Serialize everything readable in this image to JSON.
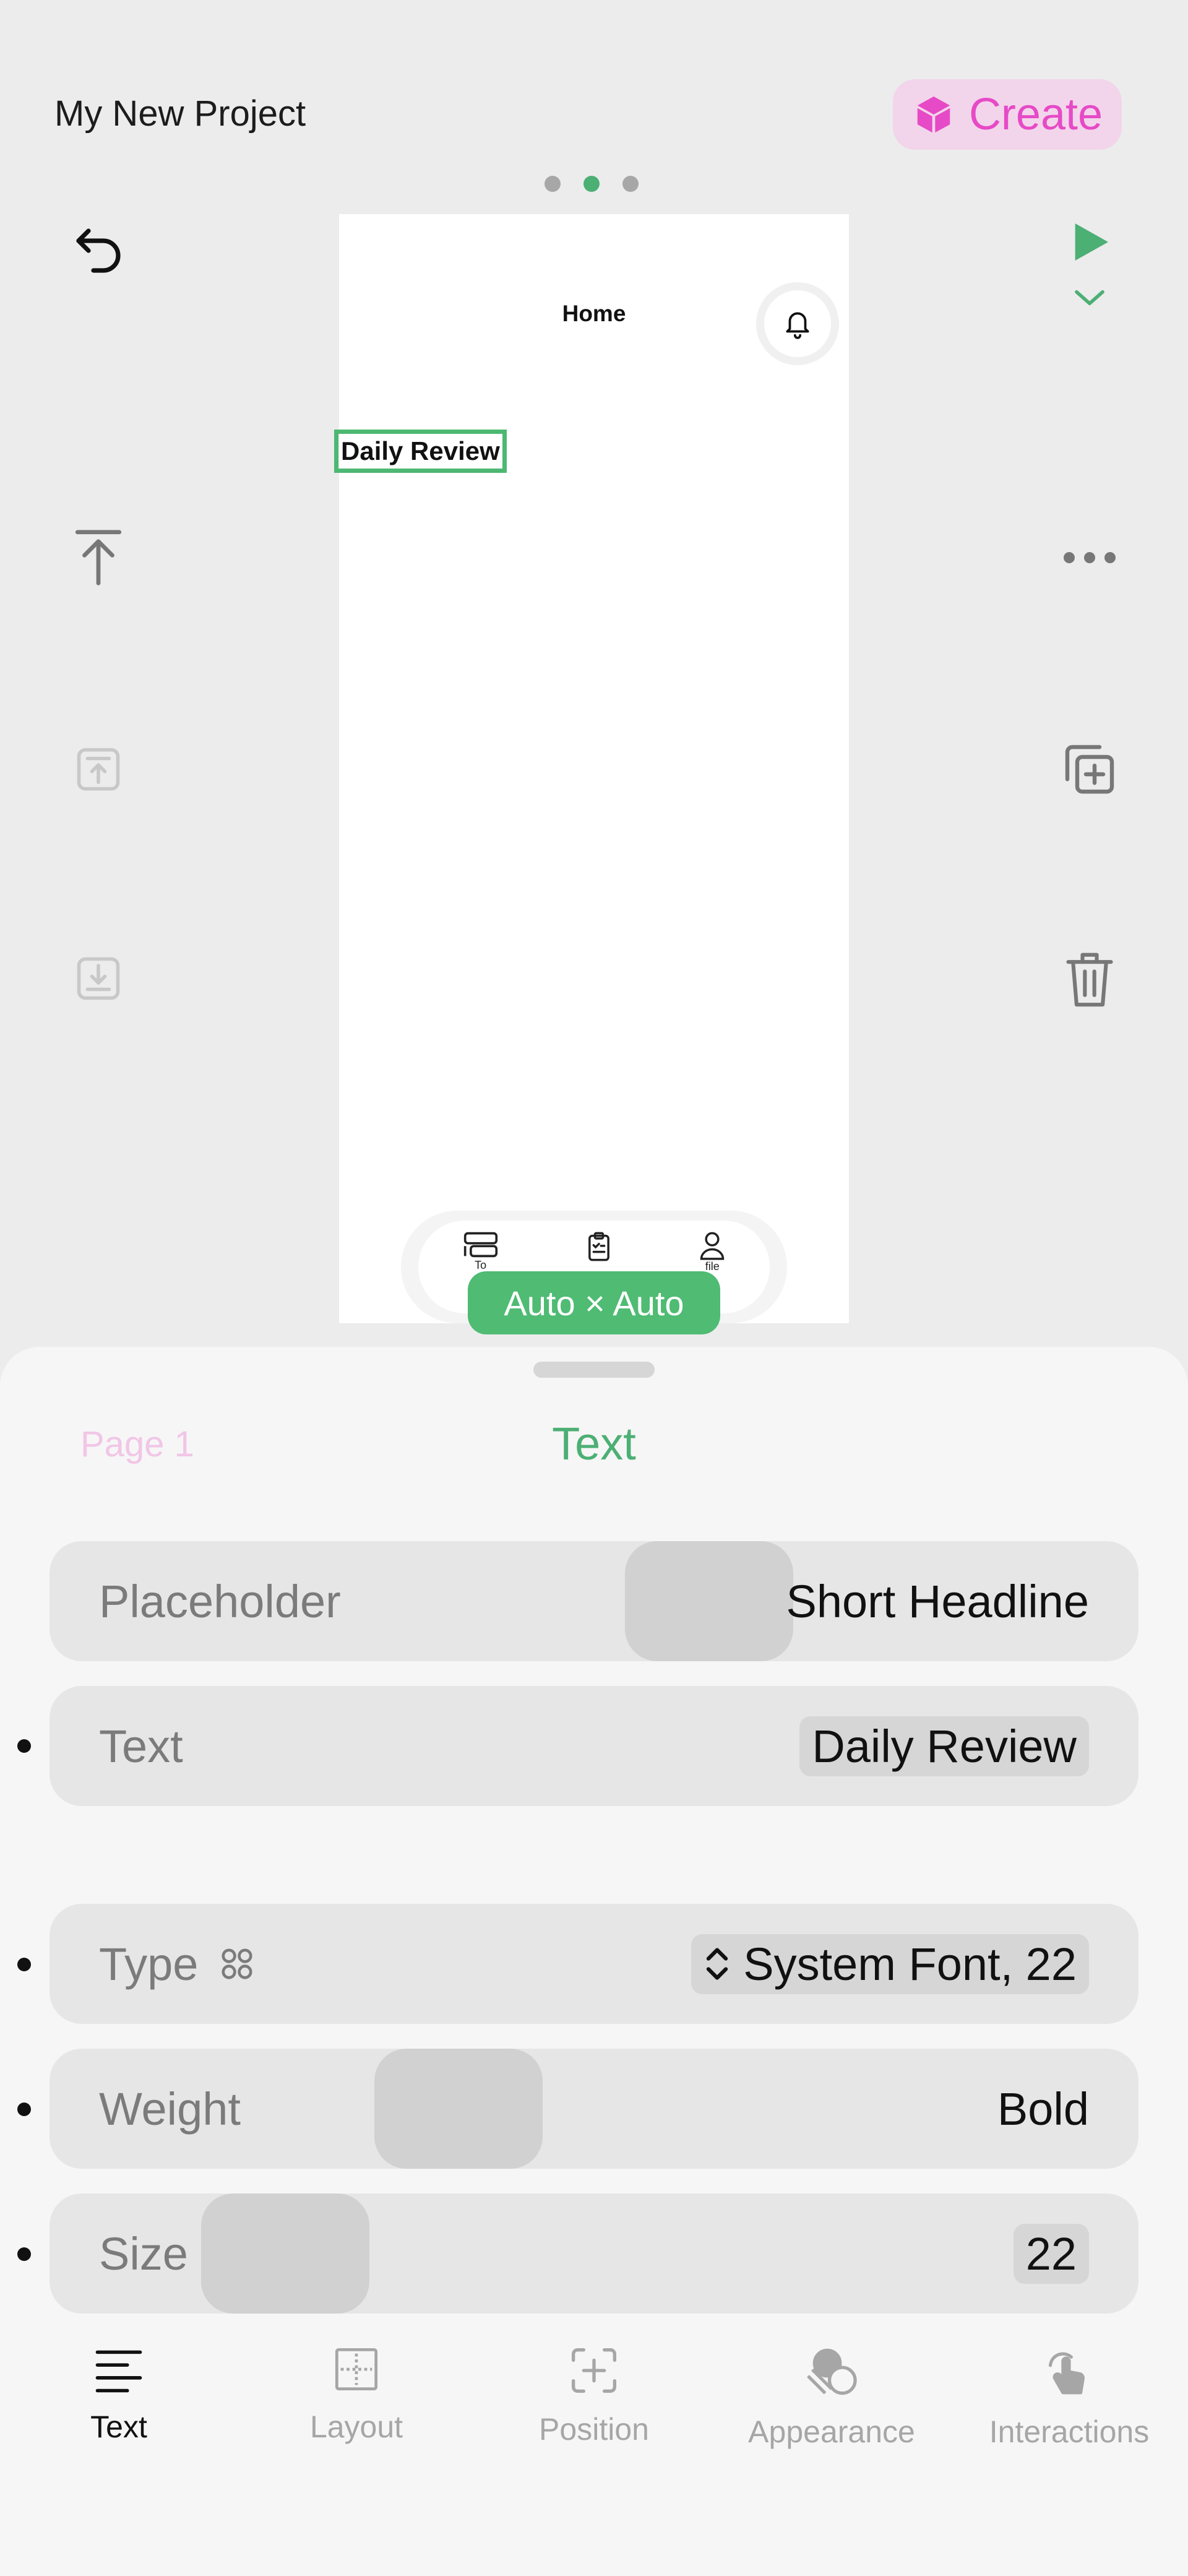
{
  "header": {
    "project_title": "My New Project",
    "create_label": "Create"
  },
  "pager": {
    "count": 3,
    "active_index": 1
  },
  "canvas": {
    "screen_title": "Home",
    "selected_text": "Daily Review",
    "tab_labels": [
      "To",
      "",
      "file"
    ],
    "size_label": "Auto × Auto"
  },
  "sheet": {
    "breadcrumb": "Page 1",
    "title": "Text",
    "rows": {
      "placeholder": {
        "label": "Placeholder",
        "value": "Short Headline"
      },
      "text": {
        "label": "Text",
        "value": "Daily Review"
      },
      "type": {
        "label": "Type",
        "value": "System Font, 22"
      },
      "weight": {
        "label": "Weight",
        "value": "Bold"
      },
      "size": {
        "label": "Size",
        "value": "22"
      }
    }
  },
  "bottom_tabs": [
    {
      "label": "Text",
      "icon": "text-align-icon",
      "active": true
    },
    {
      "label": "Layout",
      "icon": "layout-icon",
      "active": false
    },
    {
      "label": "Position",
      "icon": "position-icon",
      "active": false
    },
    {
      "label": "Appearance",
      "icon": "appearance-icon",
      "active": false
    },
    {
      "label": "Interactions",
      "icon": "tap-hand-icon",
      "active": false
    }
  ],
  "colors": {
    "accent_green": "#4caf74",
    "create_pink": "#e64ac7",
    "create_bg": "#f2d5ea",
    "sheet_bg": "#f6f6f6",
    "row_bg": "#e6e6e6"
  }
}
